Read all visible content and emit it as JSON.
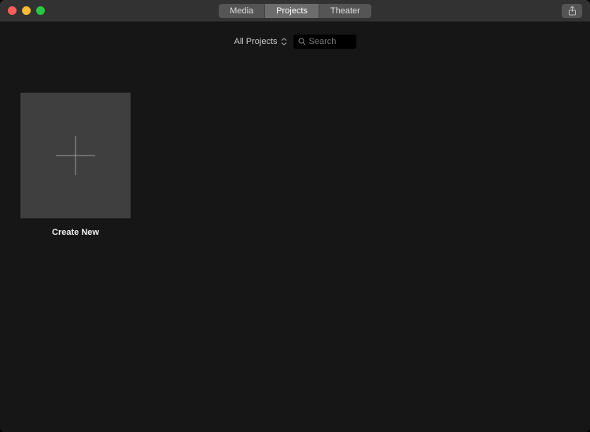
{
  "titlebar": {
    "tabs": [
      "Media",
      "Projects",
      "Theater"
    ],
    "active_tab_index": 1
  },
  "toolbar": {
    "filter_label": "All Projects",
    "search_placeholder": "Search"
  },
  "content": {
    "create_tile_label": "Create New"
  },
  "icons": {
    "share": "share-icon",
    "search": "search-icon",
    "plus": "plus-icon",
    "updown": "updown-icon"
  },
  "colors": {
    "bg": "#161616",
    "tile": "#3f3f3f",
    "titlebar": "#323232"
  }
}
